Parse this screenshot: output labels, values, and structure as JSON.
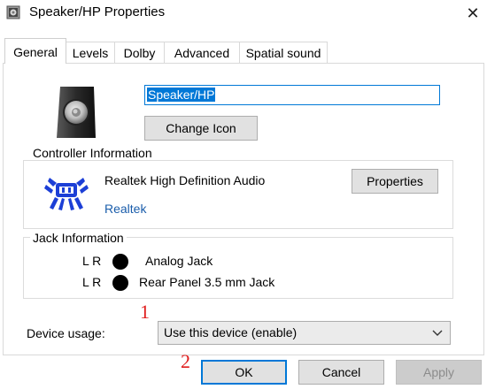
{
  "window": {
    "title": "Speaker/HP Properties",
    "close_glyph": "✕",
    "icon": "speaker-icon"
  },
  "tabs": [
    {
      "label": "General",
      "active": true
    },
    {
      "label": "Levels",
      "active": false
    },
    {
      "label": "Dolby",
      "active": false
    },
    {
      "label": "Advanced",
      "active": false
    },
    {
      "label": "Spatial sound",
      "active": false
    }
  ],
  "general": {
    "device_name": "Speaker/HP",
    "change_icon_label": "Change Icon"
  },
  "controller": {
    "heading": "Controller Information",
    "driver_name": "Realtek High Definition Audio",
    "vendor_link": "Realtek",
    "properties_label": "Properties",
    "logo": "realtek-crab-icon"
  },
  "jack": {
    "heading": "Jack Information",
    "rows": [
      {
        "channels": "L R",
        "label": "Analog Jack"
      },
      {
        "channels": "L R",
        "label": "Rear Panel 3.5 mm Jack"
      }
    ]
  },
  "annotations": {
    "one": "1",
    "two": "2",
    "color": "#e01c1c"
  },
  "usage": {
    "label": "Device usage:",
    "selected": "Use this device (enable)"
  },
  "buttons": {
    "ok": "OK",
    "cancel": "Cancel",
    "apply": "Apply"
  },
  "colors": {
    "accent": "#0078d7",
    "link": "#1a5dab",
    "logo_blue": "#1c3fd6"
  }
}
